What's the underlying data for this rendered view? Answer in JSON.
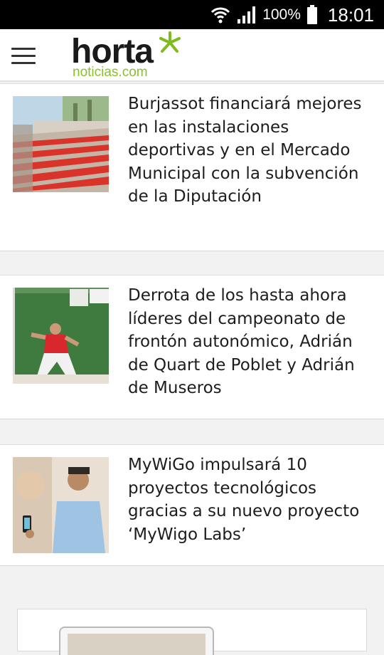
{
  "status_bar": {
    "battery": "100%",
    "time": "18:01",
    "icons": [
      "wifi-icon",
      "signal-icon",
      "battery-icon"
    ]
  },
  "app_bar": {
    "logo_main": "horta",
    "logo_sub": "noticias.com",
    "menu_icon": "hamburger-menu-icon"
  },
  "colors": {
    "logo_green": "#8bbf2c",
    "text": "#1d1d1d",
    "background": "#f2f2f2"
  },
  "articles": [
    {
      "title": "Burjassot financiará mejores en las instalaciones deportivas y en el Mercado Municipal con la subvención de la Diputación",
      "image": "stadium-seats-photo"
    },
    {
      "title": "Derrota de los hasta ahora líderes del campeonato de frontón autonómico, Adrián de Quart de Poblet y Adrián de Museros",
      "image": "fronton-player-photo"
    },
    {
      "title": "MyWiGo impulsará 10 proyectos tecnológicos gracias a su nuevo proyecto ‘MyWigo Labs’",
      "image": "presenter-photo"
    }
  ]
}
